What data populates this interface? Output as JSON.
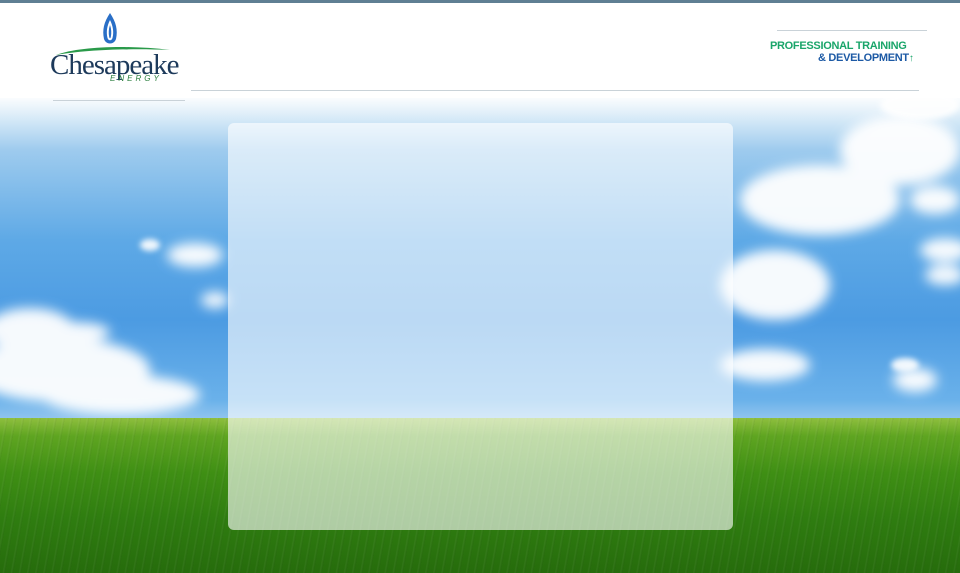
{
  "logo": {
    "wordmark": "Chesapeake",
    "subtitle": "ENERGY"
  },
  "brand": {
    "line1": "PROFESSIONAL TRAINING",
    "line2": "& DEVELOPMENT",
    "arrow": "↑"
  },
  "colors": {
    "top_rule": "#5f7f93",
    "brand_green": "#1aa56a",
    "brand_blue": "#1d5aa5",
    "logo_navy": "#1d3a5b"
  },
  "icons": {
    "logo_mark": "flame-icon",
    "brand_arrow": "up-arrow-icon"
  }
}
